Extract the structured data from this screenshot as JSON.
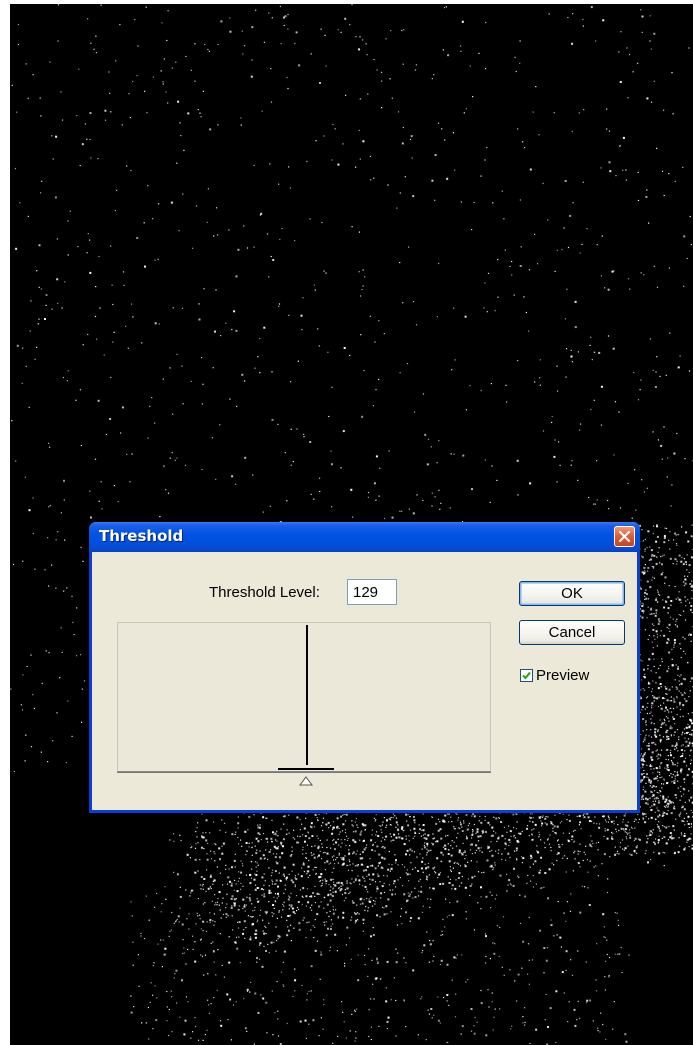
{
  "dialog": {
    "title": "Threshold",
    "threshold_level_label": "Threshold Level:",
    "threshold_level_value": "129",
    "threshold_level_max": 255,
    "ok_label": "OK",
    "cancel_label": "Cancel",
    "preview_label": "Preview",
    "preview_checked": true
  },
  "icons": {
    "close": "close-icon",
    "checkbox_check": "checkmark-icon",
    "slider": "triangle-slider-icon"
  },
  "colors": {
    "titlebar": "#0054e3",
    "dialog_bg": "#ece9d8",
    "close_button": "#e0603a",
    "background_image": "#000000",
    "speckle": "#ffffff"
  }
}
